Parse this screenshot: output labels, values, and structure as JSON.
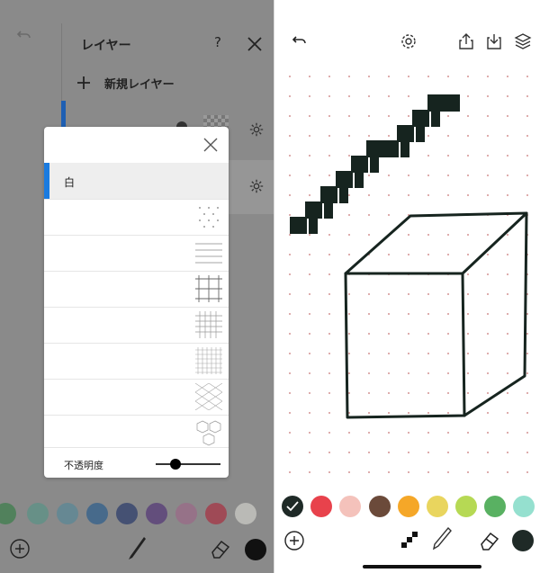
{
  "left_panel": {
    "title": "レイヤー",
    "help_label": "?",
    "new_layer_label": "新規レイヤー"
  },
  "background_modal": {
    "selected_label": "白",
    "options": [
      "white",
      "dots",
      "lines",
      "grid",
      "small-grid",
      "dense-grid",
      "isometric",
      "hexagons"
    ],
    "opacity_label": "不透明度",
    "opacity_value": 0.3
  },
  "left_palette": [
    "#3e7d4c",
    "#5b9186",
    "#5a8796",
    "#305f8b",
    "#2e3e6b",
    "#553a77",
    "#9a6a87",
    "#a63444",
    "#c9c9c4"
  ],
  "right_palette": {
    "selected": "#1f2a27",
    "colors": [
      "#1f2a27",
      "#e8424c",
      "#f4c2bb",
      "#6b4a3a",
      "#f5a728",
      "#e9d55e",
      "#b6d954",
      "#59b162",
      "#95e0cf"
    ]
  },
  "toolbar_icons": [
    "back-arrow-icon",
    "gear-icon",
    "share-icon",
    "download-icon",
    "layers-icon"
  ],
  "bottom_tools": [
    "add-icon",
    "pixel-brush-icon",
    "pen-icon",
    "eraser-icon",
    "current-color-icon"
  ]
}
